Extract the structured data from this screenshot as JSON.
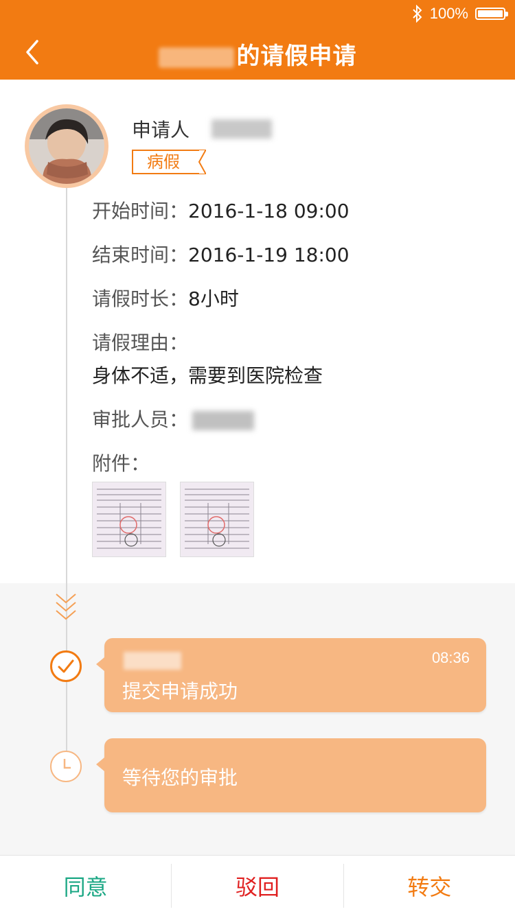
{
  "status_bar": {
    "battery_text": "100%",
    "battery_level": 1.0,
    "icons": [
      "bluetooth-icon",
      "battery-icon"
    ]
  },
  "header": {
    "title_suffix": "的请假申请",
    "back_icon": "chevron-left-icon"
  },
  "applicant": {
    "label": "申请人",
    "leave_type": "病假"
  },
  "details": {
    "start_label": "开始时间：",
    "start_value": "2016-1-18  09:00",
    "end_label": "结束时间：",
    "end_value": "2016-1-19  18:00",
    "duration_label": "请假时长：",
    "duration_value": "8小时",
    "reason_label": "请假理由：",
    "reason_value": "身体不适，需要到医院检查",
    "approver_label": "审批人员：",
    "attachments_label": "附件："
  },
  "timeline": [
    {
      "time": "08:36",
      "text": "提交申请成功",
      "icon": "check-circle-icon"
    },
    {
      "text": "等待您的审批",
      "icon": "clock-icon"
    }
  ],
  "actions": {
    "approve": "同意",
    "reject": "驳回",
    "transfer": "转交"
  },
  "colors": {
    "accent": "#f27b12",
    "bubble": "#f7b782",
    "approve": "#1ba784",
    "reject": "#e02020",
    "transfer": "#f27b12"
  }
}
